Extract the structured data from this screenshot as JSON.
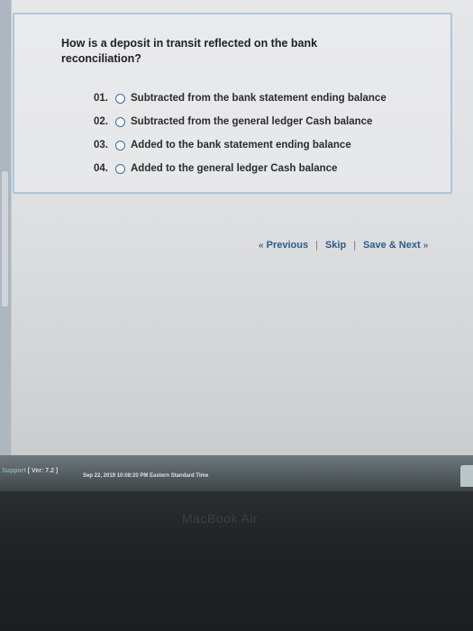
{
  "question": {
    "text": "How is a deposit in transit reflected on the bank reconciliation?"
  },
  "options": [
    {
      "number": "01.",
      "label": "Subtracted from the bank statement ending balance"
    },
    {
      "number": "02.",
      "label": "Subtracted from the general ledger Cash balance"
    },
    {
      "number": "03.",
      "label": "Added to the bank statement ending balance"
    },
    {
      "number": "04.",
      "label": "Added to the general ledger Cash balance"
    }
  ],
  "navigation": {
    "previous_label": "Previous",
    "skip_label": "Skip",
    "save_next_label": "Save & Next",
    "separator": "|",
    "prev_arrow": "«",
    "next_arrow": "»"
  },
  "status": {
    "support_label": "Support",
    "version_text": "[ Ver: 7.2 ]",
    "datetime_text": "Sep 22, 2019  10:08:20 PM Eastern Standard Time"
  },
  "device": {
    "brand_text": "MacBook Air"
  },
  "colors": {
    "accent_link": "#2e5c8a",
    "box_border": "#a9c7df",
    "radio_border": "#3f6f9a"
  }
}
